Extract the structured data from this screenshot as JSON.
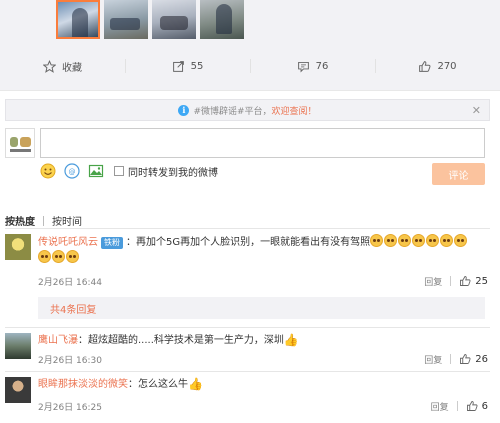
{
  "thumbnails": [
    "photo-1",
    "photo-2",
    "photo-3",
    "photo-4"
  ],
  "actions": {
    "favorite_label": "收藏",
    "repost_count": "55",
    "comment_count": "76",
    "like_count": "270"
  },
  "notice": {
    "prefix": "#微博辟谣#平台，",
    "highlight": "欢迎查阅！"
  },
  "compose": {
    "placeholder": "",
    "repost_label": "同时转发到我的微博",
    "submit_label": "评论"
  },
  "sort": {
    "hot_label": "按热度",
    "time_label": "按时间"
  },
  "comments": [
    {
      "user": "传说吒吒风云",
      "badge": "铁粉",
      "text": "：再加个5G再加个人脸识别，一眼就能看出有没有驾照",
      "time": "2月26日 16:44",
      "reply_label": "回复",
      "likes": "25",
      "more_replies": "共4条回复"
    },
    {
      "user": "鹰山飞瀑",
      "text": "：超炫超酷的.....科学技术是第一生产力，深圳",
      "time": "2月26日 16:30",
      "reply_label": "回复",
      "likes": "26"
    },
    {
      "user": "眼眸那抹淡淡的微笑",
      "text": "：怎么这么牛",
      "time": "2月26日 16:25",
      "reply_label": "回复",
      "likes": "6"
    }
  ],
  "colors": {
    "accent": "#eb7350",
    "submit": "#fbc39e",
    "badge": "#4a9bdc"
  }
}
